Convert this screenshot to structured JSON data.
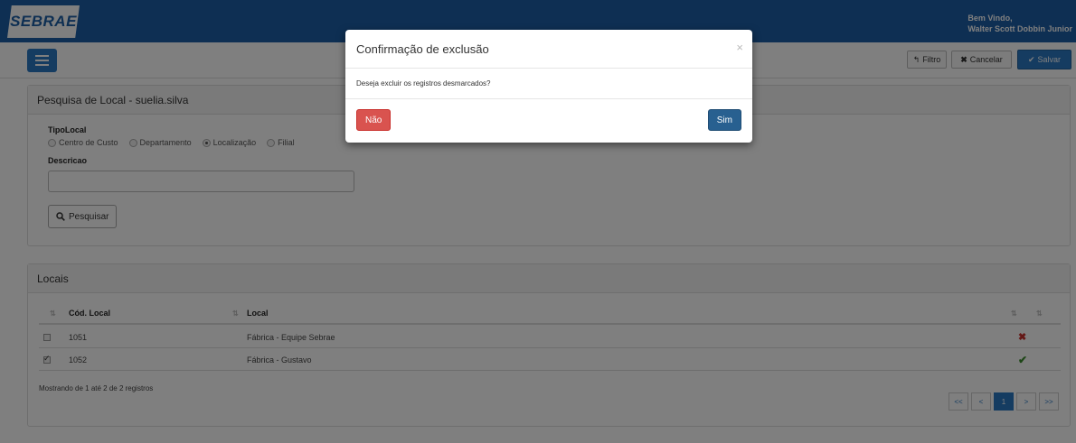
{
  "header": {
    "logo_text": "SEBRAE",
    "welcome_line": "Bem Vindo,",
    "user_name": "Walter Scott Dobbin Junior"
  },
  "toolbar": {
    "filter_label": "Filtro",
    "cancel_label": "Cancelar",
    "save_label": "Salvar"
  },
  "search_panel": {
    "title": "Pesquisa de Local - suelia.silva",
    "tipo_label": "TipoLocal",
    "options": [
      "Centro de Custo",
      "Departamento",
      "Localização",
      "Filial"
    ],
    "selected_option": "Localização",
    "descricao_label": "Descricao",
    "descricao_value": "",
    "search_button": "Pesquisar"
  },
  "locais_panel": {
    "title": "Locais",
    "columns": [
      "Cód. Local",
      "Local"
    ],
    "rows": [
      {
        "code": "1051",
        "name": "Fábrica - Equipe Sebrae",
        "checked": false,
        "status": "error"
      },
      {
        "code": "1052",
        "name": "Fábrica - Gustavo",
        "checked": true,
        "status": "ok"
      }
    ],
    "summary": "Mostrando de 1 até 2 de 2 registros",
    "pagination": [
      "<<",
      "<",
      "1",
      ">",
      ">>"
    ],
    "current_page": "1"
  },
  "modal": {
    "title": "Confirmação de exclusão",
    "close_symbol": "×",
    "message": "Deseja excluir os registros desmarcados?",
    "no_label": "Não",
    "yes_label": "Sim"
  },
  "colors": {
    "header_blue": "#1d5fa6",
    "primary": "#2b78c2",
    "danger": "#d9534f",
    "success": "#3c8d2f"
  }
}
